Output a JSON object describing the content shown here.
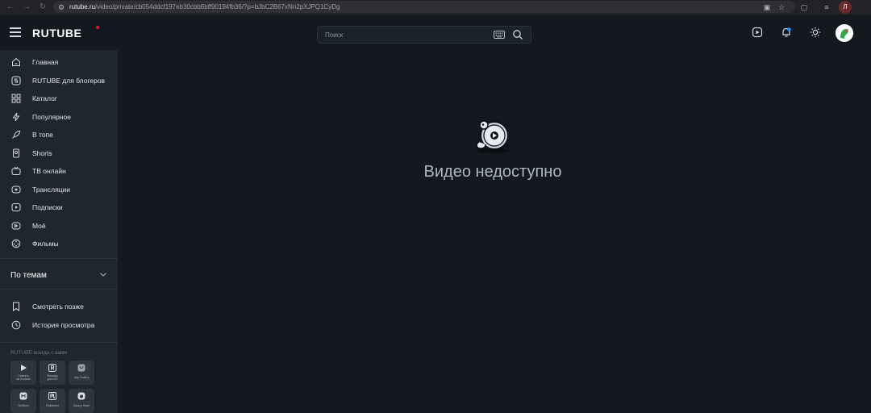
{
  "browser": {
    "url_domain": "rutube.ru",
    "url_path": "/video/private/cb054ddcf197eb30cbb6bff90194fb36/?p=bJbC2B67xNn2pXJPQ1CyDg",
    "profile_initial": "Л"
  },
  "header": {
    "logo": "RUTUBE",
    "search_placeholder": "Поиск"
  },
  "sidebar": {
    "items": [
      {
        "label": "Главная",
        "icon": "home-icon"
      },
      {
        "label": "RUTUBE для блогеров",
        "icon": "studio-icon"
      },
      {
        "label": "Каталог",
        "icon": "catalog-icon"
      },
      {
        "label": "Популярное",
        "icon": "lightning-icon"
      },
      {
        "label": "В топе",
        "icon": "rocket-icon"
      },
      {
        "label": "Shorts",
        "icon": "shorts-icon"
      },
      {
        "label": "ТВ онлайн",
        "icon": "tv-icon"
      },
      {
        "label": "Трансляции",
        "icon": "broadcast-icon"
      },
      {
        "label": "Подписки",
        "icon": "subscriptions-icon"
      },
      {
        "label": "Моё",
        "icon": "my-videos-icon"
      },
      {
        "label": "Фильмы",
        "icon": "films-icon"
      }
    ],
    "topics_label": "По темам",
    "bottom_items": [
      {
        "label": "Смотреть позже",
        "icon": "bookmark-icon"
      },
      {
        "label": "История просмотра",
        "icon": "history-icon"
      }
    ],
    "apps_title": "RUTUBE всегда с вами",
    "apps": [
      {
        "label1": "Скачать",
        "label2": "на Android",
        "icon": "google-play-icon"
      },
      {
        "label1": "Фильмы",
        "label2": "для iOS",
        "icon": "rutube-app-icon"
      },
      {
        "label1": "App Gallery",
        "label2": "",
        "icon": "app-gallery-icon"
      },
      {
        "label1": "RuStore",
        "label2": "",
        "icon": "rustore-icon"
      },
      {
        "label1": "RuMarket",
        "label2": "",
        "icon": "rumarket-icon"
      },
      {
        "label1": "Galaxy Store",
        "label2": "",
        "icon": "galaxy-store-icon"
      }
    ]
  },
  "main": {
    "message": "Видео недоступно"
  },
  "colors": {
    "background": "#14191f",
    "sidebar": "#1f262e",
    "accent": "#ed143b"
  }
}
